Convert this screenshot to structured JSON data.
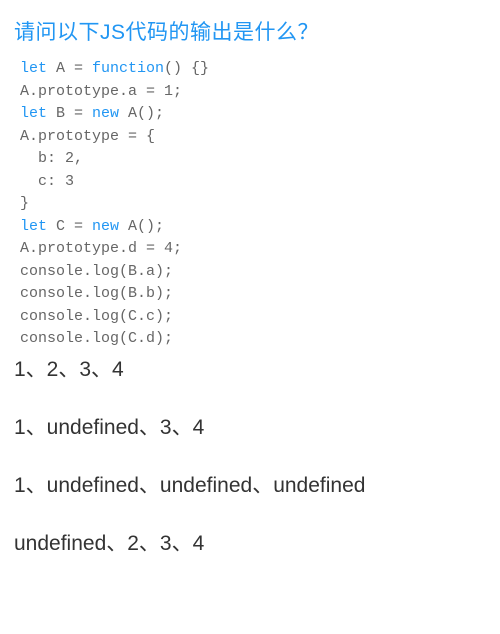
{
  "question": {
    "title": "请问以下JS代码的输出是什么？"
  },
  "code": {
    "lines": [
      {
        "parts": [
          {
            "t": "let ",
            "c": "kw-let"
          },
          {
            "t": "A = "
          },
          {
            "t": "function",
            "c": "kw-function"
          },
          {
            "t": "() {}"
          }
        ]
      },
      {
        "parts": [
          {
            "t": "A.prototype.a = 1;"
          }
        ]
      },
      {
        "parts": [
          {
            "t": "let ",
            "c": "kw-let"
          },
          {
            "t": "B = "
          },
          {
            "t": "new ",
            "c": "kw-new"
          },
          {
            "t": "A();"
          }
        ]
      },
      {
        "parts": [
          {
            "t": "A.prototype = {"
          }
        ]
      },
      {
        "parts": [
          {
            "t": "  b: 2,"
          }
        ]
      },
      {
        "parts": [
          {
            "t": "  c: 3"
          }
        ]
      },
      {
        "parts": [
          {
            "t": "}"
          }
        ]
      },
      {
        "parts": [
          {
            "t": "let ",
            "c": "kw-let"
          },
          {
            "t": "C = "
          },
          {
            "t": "new ",
            "c": "kw-new"
          },
          {
            "t": "A();"
          }
        ]
      },
      {
        "parts": [
          {
            "t": "A.prototype.d = 4;"
          }
        ]
      },
      {
        "parts": [
          {
            "t": "console.log(B.a);"
          }
        ]
      },
      {
        "parts": [
          {
            "t": "console.log(B.b);"
          }
        ]
      },
      {
        "parts": [
          {
            "t": "console.log(C.c);"
          }
        ]
      },
      {
        "parts": [
          {
            "t": "console.log(C.d);"
          }
        ]
      }
    ]
  },
  "options": [
    "1、2、3、4",
    "1、undefined、3、4",
    "1、undefined、undefined、undefined",
    "undefined、2、3、4"
  ]
}
